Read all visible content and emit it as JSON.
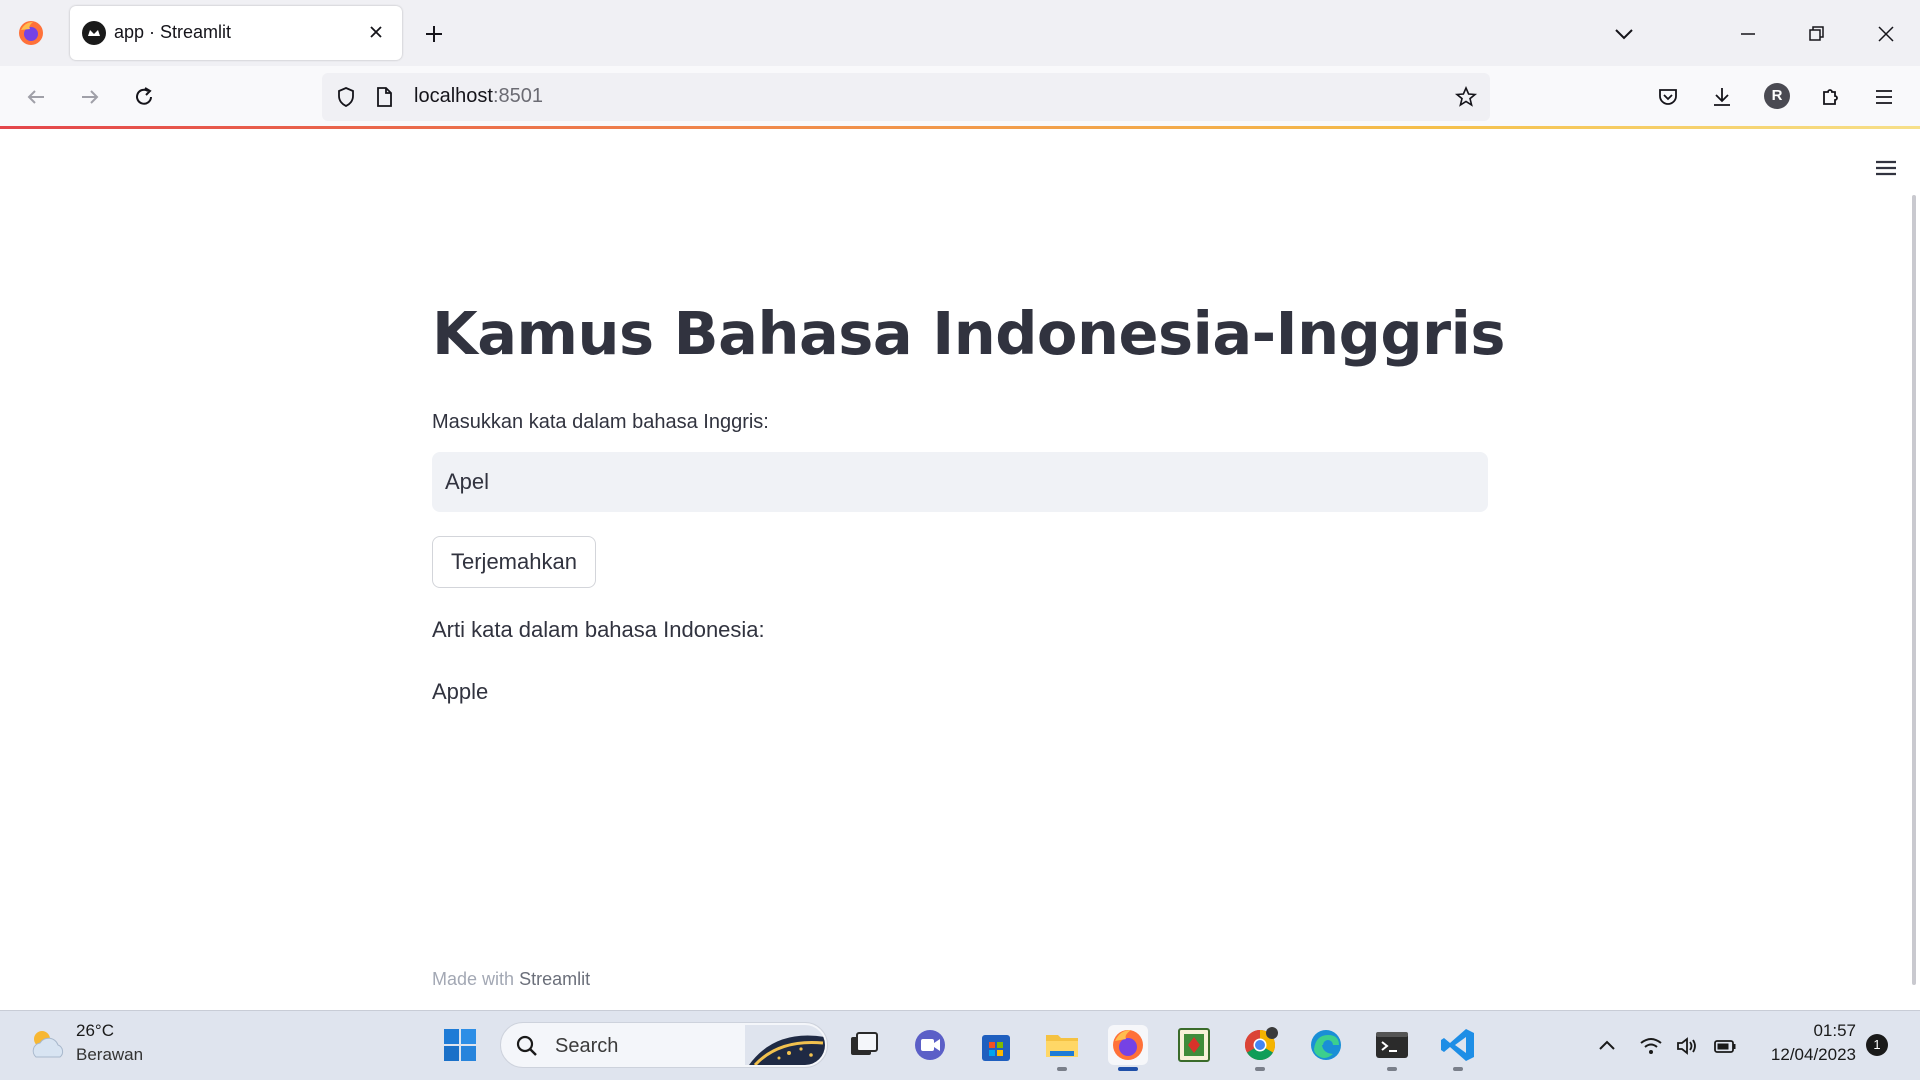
{
  "browser": {
    "tab": {
      "title": "app · Streamlit"
    },
    "url": {
      "host": "localhost",
      "port": ":8501"
    },
    "account_initial": "R"
  },
  "app": {
    "title": "Kamus Bahasa Indonesia-Inggris",
    "input_label": "Masukkan kata dalam bahasa Inggris:",
    "input_value": "Apel",
    "button_label": "Terjemahkan",
    "result_label": "Arti kata dalam bahasa Indonesia:",
    "result_value": "Apple",
    "footer_prefix": "Made with",
    "footer_brand": "Streamlit"
  },
  "taskbar": {
    "weather": {
      "temp": "26°C",
      "desc": "Berawan"
    },
    "search_placeholder": "Search",
    "clock": {
      "time": "01:57",
      "date": "12/04/2023"
    },
    "notification_count": "1"
  },
  "colors": {
    "text": "#31333f",
    "input_bg": "#f0f2f6",
    "firefox_accent": "#ff7139",
    "footer": "#a3a8b4"
  }
}
